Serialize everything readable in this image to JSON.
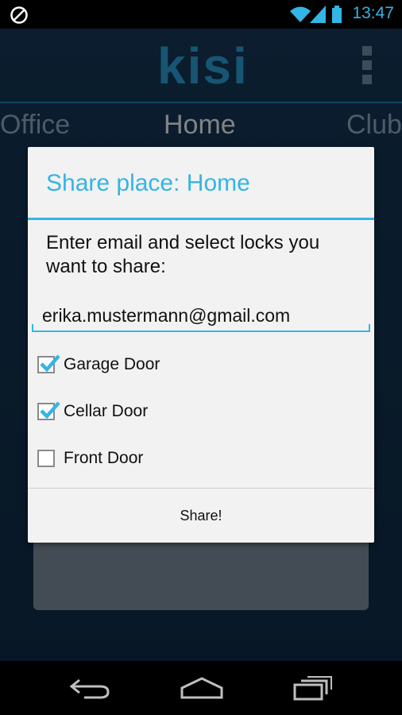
{
  "status_bar": {
    "time": "13:47"
  },
  "app": {
    "logo": "kisi",
    "tabs": [
      "Office",
      "Home",
      "Club"
    ]
  },
  "dialog": {
    "title": "Share place: Home",
    "message": "Enter email and select locks you want to share:",
    "email": {
      "value": "erika.mustermann@gmail.com",
      "placeholder": ""
    },
    "locks": [
      {
        "label": "Garage Door",
        "checked": true
      },
      {
        "label": "Cellar Door",
        "checked": true
      },
      {
        "label": "Front Door",
        "checked": false
      }
    ],
    "share_label": "Share!"
  },
  "colors": {
    "accent": "#33b5e5",
    "app_bg": "#143654",
    "dialog_bg": "#f2f2f2"
  }
}
